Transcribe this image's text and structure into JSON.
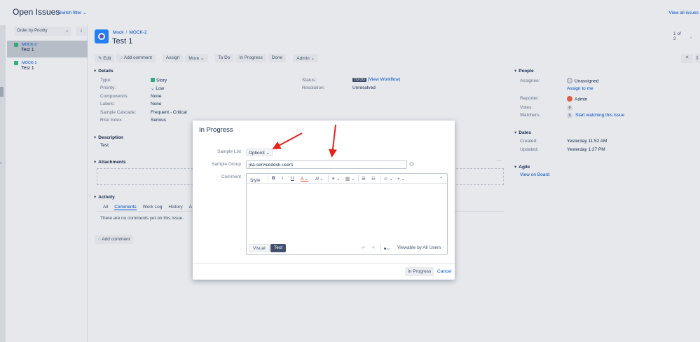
{
  "header": {
    "title": "Open Issues",
    "switch_filter": "Switch filter",
    "view_all": "View all issues"
  },
  "list": {
    "order_label": "Order by Priority",
    "order_dir_icon": "arrow-down-icon",
    "items": [
      {
        "key": "MOCK-2",
        "summary": "Test 1",
        "selected": true
      },
      {
        "key": "MOCK-1",
        "summary": "Test 1",
        "selected": false
      }
    ]
  },
  "issue": {
    "project": "Mock",
    "key": "MOCK-2",
    "title": "Test 1",
    "pager": "1 of 2"
  },
  "toolbar": {
    "edit": "Edit",
    "add_comment": "Add comment",
    "assign": "Assign",
    "more": "More",
    "todo": "To Do",
    "in_progress": "In Progress",
    "done": "Done",
    "admin": "Admin"
  },
  "details": {
    "heading": "Details",
    "type_label": "Type:",
    "type_value": "Story",
    "priority_label": "Priority:",
    "priority_value": "Low",
    "components_label": "Component/s:",
    "components_value": "None",
    "labels_label": "Labels:",
    "labels_value": "None",
    "cascade_label": "Sample Cascade:",
    "cascade_value": "Frequent - Critical",
    "risk_label": "Risk Index:",
    "risk_value": "Serious",
    "status_label": "Status:",
    "status_value": "TO DO",
    "view_workflow": "(View Workflow)",
    "resolution_label": "Resolution:",
    "resolution_value": "Unresolved"
  },
  "description": {
    "heading": "Description",
    "text": "Test"
  },
  "attachments": {
    "heading": "Attachments"
  },
  "activity": {
    "heading": "Activity",
    "tabs": [
      "All",
      "Comments",
      "Work Log",
      "History",
      "A"
    ],
    "active_tab": "Comments",
    "empty": "There are no comments yet on this issue.",
    "add_comment": "Add comment"
  },
  "people": {
    "heading": "People",
    "assignee_label": "Assignee:",
    "assignee_value": "Unassigned",
    "assign_to_me": "Assign to me",
    "reporter_label": "Reporter:",
    "reporter_value": "Admin",
    "votes_label": "Votes:",
    "votes_count": "0",
    "watchers_label": "Watchers:",
    "watchers_count": "0",
    "watch_link": "Start watching this issue"
  },
  "dates": {
    "heading": "Dates",
    "created_label": "Created:",
    "created_value": "Yesterday 11:52 AM",
    "updated_label": "Updated:",
    "updated_value": "Yesterday 1:27 PM"
  },
  "agile": {
    "heading": "Agile",
    "view_on_board": "View on Board"
  },
  "dialog": {
    "title": "In Progress",
    "sample_list_label": "Sample List",
    "sample_list_value": "Option3",
    "sample_group_label": "Sample Group",
    "sample_group_value": "jira-servicedesk-users",
    "comment_label": "Comment",
    "style_label": "Style",
    "tab_visual": "Visual",
    "tab_text": "Text",
    "visibility": "Viewable by All Users",
    "submit": "In Progress",
    "cancel": "Cancel"
  },
  "colors": {
    "accent": "#0052cc",
    "arrow": "#e8221b",
    "story": "#36b37e"
  }
}
